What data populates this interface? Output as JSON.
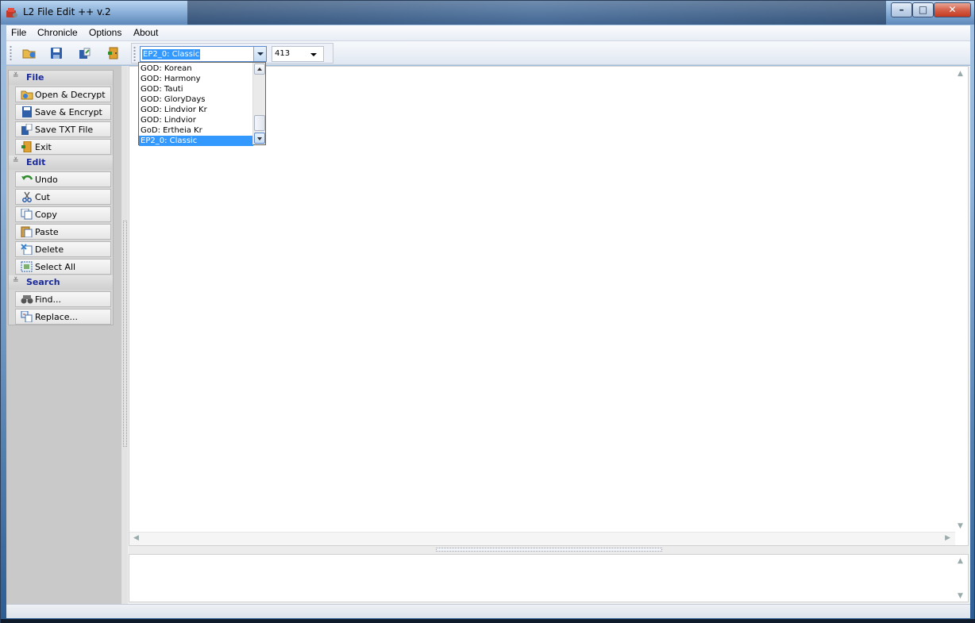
{
  "window": {
    "title": "L2 File Edit ++ v.2"
  },
  "menu": [
    "File",
    "Chronicle",
    "Options",
    "About"
  ],
  "toolbar": {
    "chronicle_value": "EP2_0: Classic",
    "protocol_value": "413"
  },
  "chronicle_options": [
    "GOD: Korean",
    "GOD: Harmony",
    "GOD: Tauti",
    "GOD: GloryDays",
    "GOD: Lindvior Kr",
    "GOD: Lindvior",
    "GoD: Ertheia Kr",
    "EP2_0: Classic"
  ],
  "sidebar": {
    "file": {
      "title": "File",
      "items": [
        "Open & Decrypt",
        "Save & Encrypt",
        "Save TXT File",
        "Exit"
      ]
    },
    "edit": {
      "title": "Edit",
      "items": [
        "Undo",
        "Cut",
        "Copy",
        "Paste",
        "Delete",
        "Select All"
      ]
    },
    "search": {
      "title": "Search",
      "items": [
        "Find...",
        "Replace..."
      ]
    }
  },
  "colors": {
    "selection": "#3399ff",
    "section_title": "#1a2a9a",
    "sidebar_bg": "#c9c9c9"
  }
}
